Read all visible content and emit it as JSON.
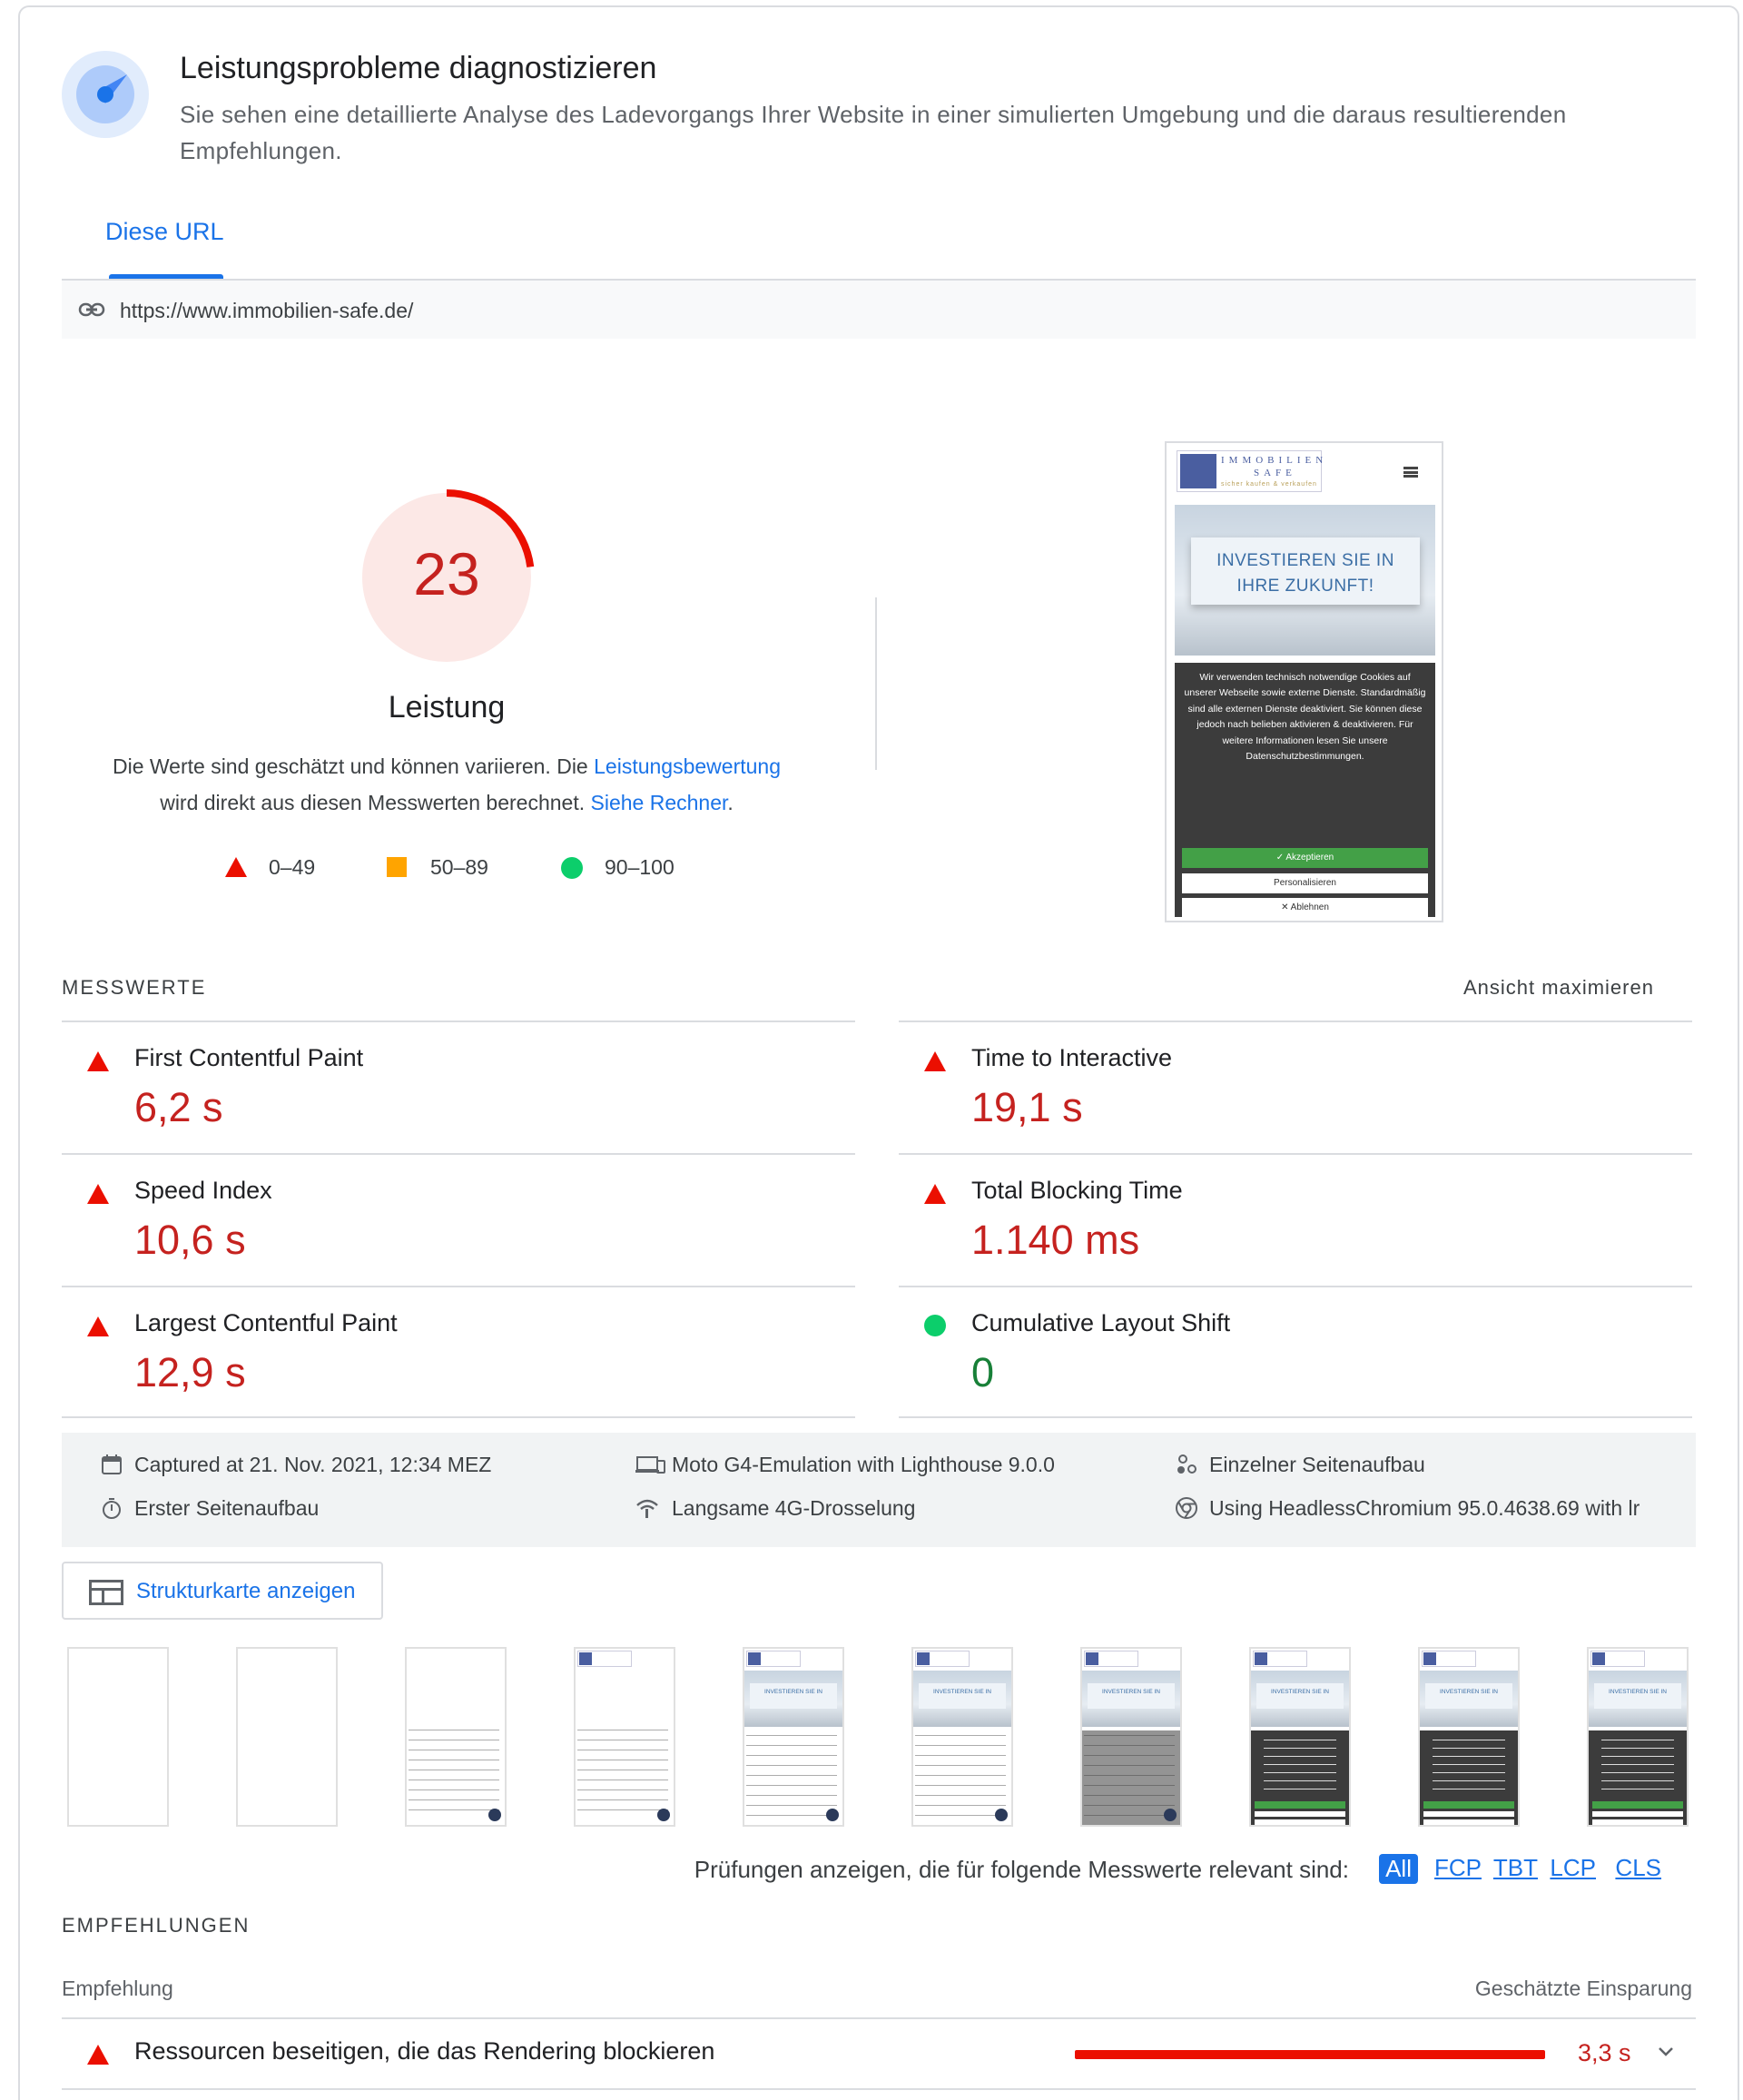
{
  "header": {
    "title": "Leistungsprobleme diagnostizieren",
    "description": "Sie sehen eine detaillierte Analyse des Ladevorgangs Ihrer Website in einer simulierten Umgebung und die daraus resultierenden Empfehlungen."
  },
  "tabs": [
    {
      "label": "Diese URL",
      "active": true
    }
  ],
  "url": "https://www.immobilien-safe.de/",
  "gauge": {
    "score": "23",
    "score_fraction": 0.23,
    "label": "Leistung",
    "desc_part1": "Die Werte sind geschätzt und können variieren. Die ",
    "desc_link1": "Leistungsbewertung",
    "desc_part2": " wird direkt aus diesen Messwerten berechnet. ",
    "desc_link2": "Siehe Rechner",
    "desc_part3": "."
  },
  "legend": [
    {
      "range": "0–49",
      "shape": "triangle",
      "color": "#eb0f00"
    },
    {
      "range": "50–89",
      "shape": "square",
      "color": "#ffa400"
    },
    {
      "range": "90–100",
      "shape": "circle",
      "color": "#0cce6b"
    }
  ],
  "screenshot": {
    "logo_line1": "IMMOBILIEN",
    "logo_line2": "SAFE",
    "logo_tagline": "sicher kaufen & verkaufen",
    "hero_line1": "INVESTIEREN SIE IN",
    "hero_line2": "IHRE ZUKUNFT!",
    "cookie_text": "Wir verwenden technisch notwendige Cookies auf unserer Webseite sowie externe Dienste. Standardmäßig sind alle externen Dienste deaktiviert. Sie können diese jedoch nach belieben aktivieren & deaktivieren. Für weitere Informationen lesen Sie unsere Datenschutzbestimmungen.",
    "btn_accept": "✓ Akzeptieren",
    "btn_personalize": "Personalisieren",
    "btn_decline": "✕ Ablehnen"
  },
  "metrics_section": {
    "title": "MESSWERTE",
    "maximize": "Ansicht maximieren"
  },
  "metrics": [
    {
      "label": "First Contentful Paint",
      "value": "6,2 s",
      "status": "fail"
    },
    {
      "label": "Time to Interactive",
      "value": "19,1 s",
      "status": "fail"
    },
    {
      "label": "Speed Index",
      "value": "10,6 s",
      "status": "fail"
    },
    {
      "label": "Total Blocking Time",
      "value": "1.140 ms",
      "status": "fail"
    },
    {
      "label": "Largest Contentful Paint",
      "value": "12,9 s",
      "status": "fail"
    },
    {
      "label": "Cumulative Layout Shift",
      "value": "0",
      "status": "pass"
    }
  ],
  "environment": {
    "captured": "Captured at 21. Nov. 2021, 12:34 MEZ",
    "device": "Moto G4-Emulation with Lighthouse 9.0.0",
    "session": "Einzelner Seitenaufbau",
    "load": "Erster Seitenaufbau",
    "throttling": "Langsame 4G-Drosselung",
    "browser": "Using HeadlessChromium 95.0.4638.69 with lr"
  },
  "treemap_button": "Strukturkarte anzeigen",
  "filmstrip": {
    "frames": [
      "blank",
      "blank",
      "text",
      "hero-text",
      "hero-text",
      "hero-text",
      "hero-half",
      "hero-cookie",
      "hero-cookie",
      "hero-cookie"
    ]
  },
  "filter": {
    "label": "Prüfungen anzeigen, die für folgende Messwerte relevant sind:",
    "chips": [
      "All",
      "FCP",
      "TBT",
      "LCP",
      "CLS"
    ],
    "active": "All"
  },
  "recommendations": {
    "section_title": "EMPFEHLUNGEN",
    "col_left": "Empfehlung",
    "col_right": "Geschätzte Einsparung",
    "items": [
      {
        "title": "Ressourcen beseitigen, die das Rendering blockieren",
        "saving": "3,3 s",
        "status": "fail"
      }
    ]
  }
}
